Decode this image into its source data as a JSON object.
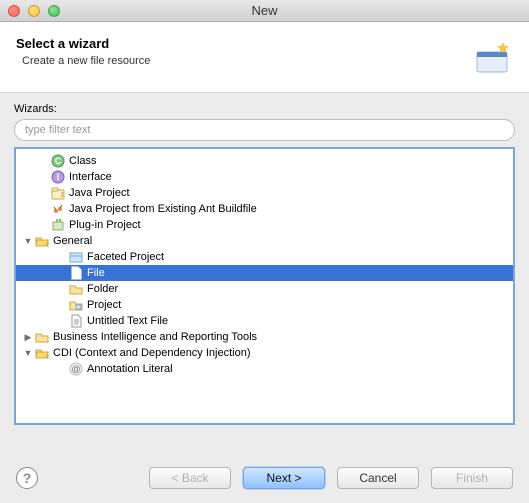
{
  "window": {
    "title": "New"
  },
  "header": {
    "title": "Select a wizard",
    "subtitle": "Create a new file resource"
  },
  "labels": {
    "wizards": "Wizards:"
  },
  "filter": {
    "placeholder": "type filter text",
    "value": ""
  },
  "tree": {
    "items": [
      {
        "label": "Class",
        "icon": "class",
        "depth": 1,
        "twisty": ""
      },
      {
        "label": "Interface",
        "icon": "interface",
        "depth": 1,
        "twisty": ""
      },
      {
        "label": "Java Project",
        "icon": "java-project",
        "depth": 1,
        "twisty": ""
      },
      {
        "label": "Java Project from Existing Ant Buildfile",
        "icon": "ant",
        "depth": 1,
        "twisty": ""
      },
      {
        "label": "Plug-in Project",
        "icon": "plugin",
        "depth": 1,
        "twisty": ""
      },
      {
        "label": "General",
        "icon": "folder-open",
        "depth": 0,
        "twisty": "down"
      },
      {
        "label": "Faceted Project",
        "icon": "faceted",
        "depth": 2,
        "twisty": ""
      },
      {
        "label": "File",
        "icon": "file",
        "depth": 2,
        "twisty": "",
        "selected": true
      },
      {
        "label": "Folder",
        "icon": "folder",
        "depth": 2,
        "twisty": ""
      },
      {
        "label": "Project",
        "icon": "project",
        "depth": 2,
        "twisty": ""
      },
      {
        "label": "Untitled Text File",
        "icon": "text-file",
        "depth": 2,
        "twisty": ""
      },
      {
        "label": "Business Intelligence and Reporting Tools",
        "icon": "folder",
        "depth": 0,
        "twisty": "right"
      },
      {
        "label": "CDI (Context and Dependency Injection)",
        "icon": "folder-open",
        "depth": 0,
        "twisty": "down"
      },
      {
        "label": "Annotation Literal",
        "icon": "annotation",
        "depth": 2,
        "twisty": ""
      }
    ]
  },
  "buttons": {
    "back": "< Back",
    "next": "Next >",
    "cancel": "Cancel",
    "finish": "Finish"
  }
}
